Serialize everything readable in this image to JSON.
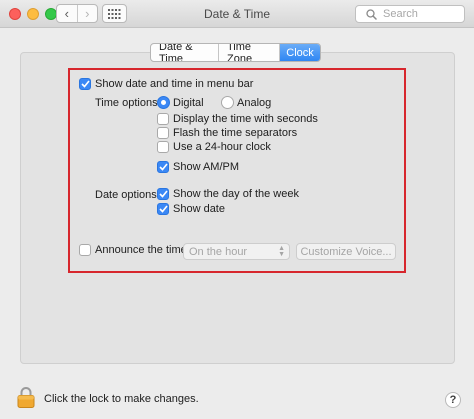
{
  "window": {
    "title": "Date & Time"
  },
  "toolbar": {
    "back_icon": "chevron-left-icon",
    "forward_icon": "chevron-right-icon",
    "grid_icon": "grid-icon",
    "search_placeholder": "Search"
  },
  "tabs": [
    {
      "label": "Date & Time",
      "active": false
    },
    {
      "label": "Time Zone",
      "active": false
    },
    {
      "label": "Clock",
      "active": true
    }
  ],
  "clock": {
    "show_in_menu_bar": {
      "label": "Show date and time in menu bar",
      "checked": true
    },
    "time_options": {
      "label": "Time options:",
      "digital": {
        "label": "Digital",
        "selected": true
      },
      "analog": {
        "label": "Analog",
        "selected": false
      },
      "seconds": {
        "label": "Display the time with seconds",
        "checked": false
      },
      "flash": {
        "label": "Flash the time separators",
        "checked": false
      },
      "clock24": {
        "label": "Use a 24-hour clock",
        "checked": false
      },
      "ampm": {
        "label": "Show AM/PM",
        "checked": true
      }
    },
    "date_options": {
      "label": "Date options:",
      "day_of_week": {
        "label": "Show the day of the week",
        "checked": true
      },
      "show_date": {
        "label": "Show date",
        "checked": true
      }
    },
    "announce": {
      "label": "Announce the time:",
      "checked": false,
      "interval_value": "On the hour",
      "customize_voice_label": "Customize Voice..."
    }
  },
  "footer": {
    "lock_text": "Click the lock to make changes.",
    "help_label": "?"
  },
  "colors": {
    "accent": "#3b88f5",
    "highlight_border": "#d7262d",
    "lock": "#f0a830"
  }
}
